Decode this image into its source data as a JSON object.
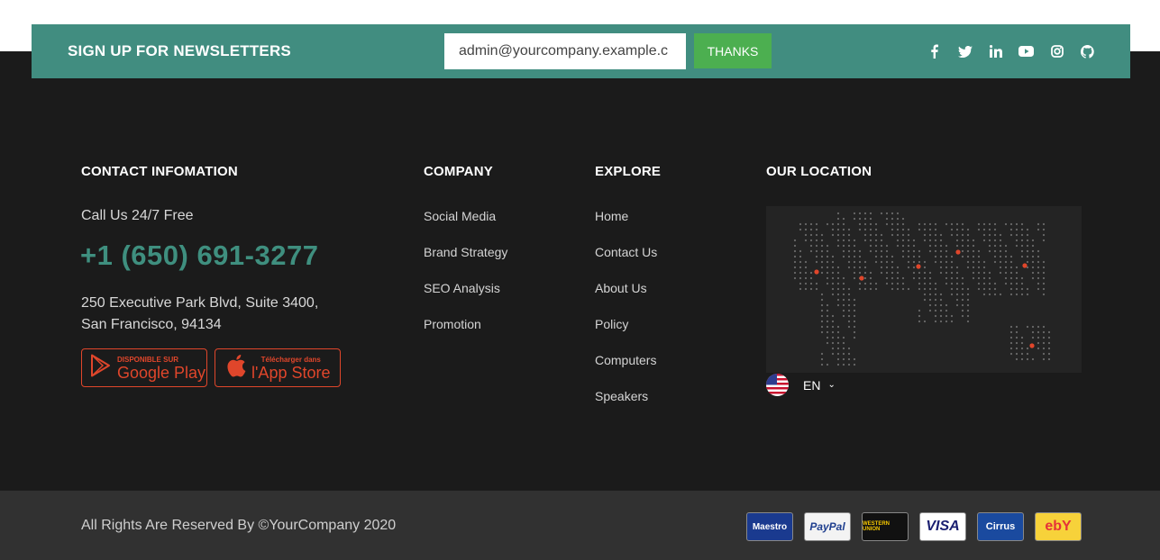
{
  "newsletter": {
    "title": "SIGN UP FOR NEWSLETTERS",
    "email_value": "admin@yourcompany.example.c",
    "button_label": "THANKS",
    "social_icons": [
      "facebook-icon",
      "twitter-icon",
      "linkedin-icon",
      "youtube-icon",
      "instagram-icon",
      "github-icon"
    ]
  },
  "contact": {
    "heading": "CONTACT INFOMATION",
    "call_label": "Call Us 24/7 Free",
    "phone": "+1 (650) 691-3277",
    "address_line1": "250 Executive Park Blvd, Suite 3400,",
    "address_line2": "San Francisco, 94134",
    "google_play": {
      "small": "DISPONIBLE SUR",
      "big": "Google Play"
    },
    "app_store": {
      "small": "Télécharger dans",
      "big": "l'App Store"
    }
  },
  "company": {
    "heading": "COMPANY",
    "links": [
      "Social Media",
      "Brand Strategy",
      "SEO Analysis",
      "Promotion"
    ]
  },
  "explore": {
    "heading": "EXPLORE",
    "links": [
      "Home",
      "Contact Us",
      "About Us",
      "Policy",
      "Computers",
      "Speakers"
    ]
  },
  "location": {
    "heading": "OUR LOCATION",
    "language": "EN"
  },
  "bottom": {
    "copyright": "All Rights Are Reserved By ©YourCompany 2020",
    "payments": [
      {
        "name": "Maestro",
        "bg": "#1a3a8f",
        "fg": "#ffffff"
      },
      {
        "name": "PayPal",
        "bg": "#f3f3f3",
        "fg": "#1f3f8f"
      },
      {
        "name": "WESTERN UNION",
        "bg": "#111111",
        "fg": "#f7c800"
      },
      {
        "name": "VISA",
        "bg": "#ffffff",
        "fg": "#1a1f71"
      },
      {
        "name": "Cirrus",
        "bg": "#1a4a9f",
        "fg": "#ffffff"
      },
      {
        "name": "ebY",
        "bg": "#f7d23a",
        "fg": "#e53238"
      }
    ]
  },
  "colors": {
    "accent": "#418d80",
    "phone": "#3f8f7f",
    "thanks": "#4caf50",
    "store": "#e0462b",
    "footer_bg": "#1b1b1b",
    "bottom_bg": "#313131"
  }
}
